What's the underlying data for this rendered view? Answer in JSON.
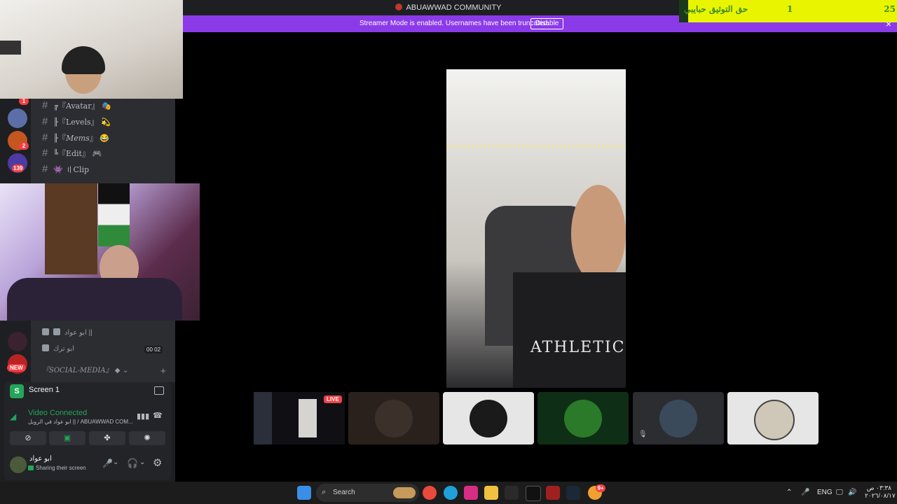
{
  "window": {
    "title": "ABUAWWAD COMMUNITY"
  },
  "streamer_banner": {
    "text": "Streamer Mode is enabled. Usernames have been truncated.",
    "button": "Disable",
    "close": "×"
  },
  "overlay": {
    "left_count": "25",
    "middle_count": "1",
    "text": "حق التوثيق حبايبي"
  },
  "servers": [
    {
      "badge": "1"
    },
    {
      "badge": ""
    },
    {
      "badge": "2"
    },
    {
      "badge": "139"
    },
    {
      "badge": "NEW"
    }
  ],
  "channels": [
    {
      "prefix": "╔『",
      "name": "Avatar",
      "suffix": "』",
      "emoji": "🎭"
    },
    {
      "prefix": "╟『",
      "name": "Levels",
      "suffix": "』",
      "emoji": "💫"
    },
    {
      "prefix": "╟『",
      "name": "Mems",
      "suffix": "』",
      "emoji": "😂"
    },
    {
      "prefix": "╚『",
      "name": "Edit",
      "suffix": "』",
      "emoji": "🎮"
    },
    {
      "prefix": "👾 〢",
      "name": "Clip",
      "suffix": "",
      "emoji": ""
    }
  ],
  "voice_users": [
    {
      "name": "ابو عواد ||",
      "timer": ""
    },
    {
      "name": "ابو ترك",
      "timer": "00 02"
    }
  ],
  "category": {
    "name": "『SOCIAL-MEDIA』",
    "add": "+"
  },
  "screen_panel": {
    "label": "Screen 1"
  },
  "voice_panel": {
    "status": "Video Connected",
    "detail": "ابو عواد في الرويل || / ABUAWWAD COM..."
  },
  "user_panel": {
    "name": "ابو عواد",
    "status": "Sharing their screen"
  },
  "live_badge": "LIVE",
  "taskbar": {
    "search_placeholder": "Search",
    "lang": "ENG",
    "time": "٠٣:٣٨ ص",
    "date": "٢٠٢٦/٠٨/١٧",
    "notif_badge": "9+"
  },
  "colors": {
    "streamer": "#8b3ae8",
    "accent_green": "#23a55a",
    "overlay": "#e9f500"
  }
}
